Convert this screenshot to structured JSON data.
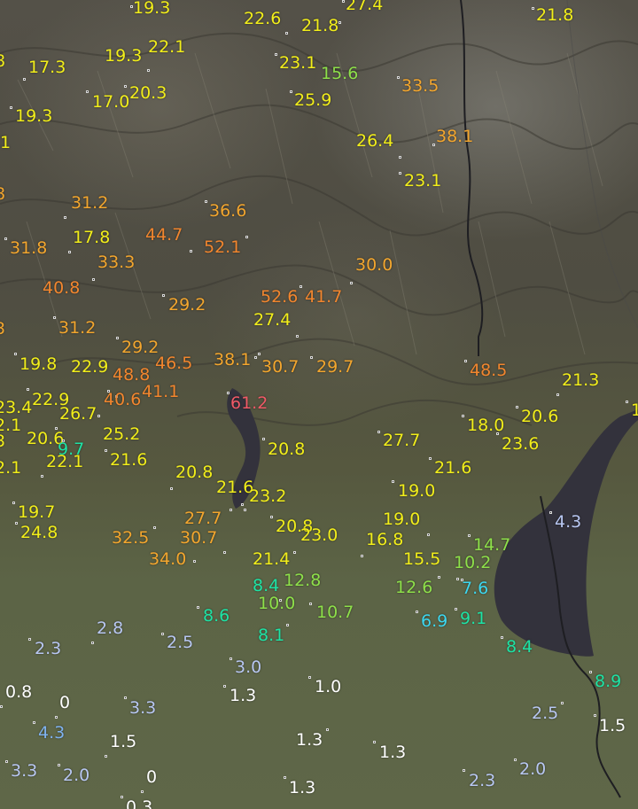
{
  "map": {
    "colors": {
      "water": "#33323c",
      "white": "#ffffff",
      "lightblue": "#b8c7f2",
      "blue": "#7fb2ee",
      "cyan": "#3cd7f0",
      "teal": "#1ee3a5",
      "green": "#8ee04a",
      "yellow": "#f2ee1a",
      "orange": "#f3a62e",
      "darkorange": "#f2862e",
      "red": "#f05a67"
    },
    "stations": [
      {
        "text": "19.3",
        "c": "yellow"
      },
      {
        "text": "22.6",
        "c": "yellow"
      },
      {
        "text": "21.8",
        "c": "yellow"
      },
      {
        "text": "27.4",
        "c": "yellow"
      },
      {
        "text": "21.8",
        "c": "yellow"
      },
      {
        "text": "17.3",
        "c": "yellow"
      },
      {
        "text": "19.3",
        "c": "yellow"
      },
      {
        "text": "22.1",
        "c": "yellow"
      },
      {
        "text": "23.1",
        "c": "yellow"
      },
      {
        "text": "15.6",
        "c": "green"
      },
      {
        "text": "33.5",
        "c": "orange"
      },
      {
        "text": "17.0",
        "c": "yellow"
      },
      {
        "text": "20.3",
        "c": "yellow"
      },
      {
        "text": "25.9",
        "c": "yellow"
      },
      {
        "text": "19.3",
        "c": "yellow"
      },
      {
        "text": "26.4",
        "c": "yellow"
      },
      {
        "text": "38.1",
        "c": "orange"
      },
      {
        "text": "23.1",
        "c": "yellow"
      },
      {
        "text": "31.2",
        "c": "orange"
      },
      {
        "text": "36.6",
        "c": "orange"
      },
      {
        "text": "17.8",
        "c": "yellow"
      },
      {
        "text": "44.7",
        "c": "darkorange"
      },
      {
        "text": "52.1",
        "c": "darkorange"
      },
      {
        "text": "31.8",
        "c": "orange"
      },
      {
        "text": "33.3",
        "c": "orange"
      },
      {
        "text": "30.0",
        "c": "orange"
      },
      {
        "text": "40.8",
        "c": "darkorange"
      },
      {
        "text": "52.6",
        "c": "darkorange"
      },
      {
        "text": "41.7",
        "c": "darkorange"
      },
      {
        "text": "29.2",
        "c": "orange"
      },
      {
        "text": "27.4",
        "c": "yellow"
      },
      {
        "text": "31.2",
        "c": "orange"
      },
      {
        "text": "29.2",
        "c": "orange"
      },
      {
        "text": "19.8",
        "c": "yellow"
      },
      {
        "text": "22.9",
        "c": "yellow"
      },
      {
        "text": "48.8",
        "c": "darkorange"
      },
      {
        "text": "46.5",
        "c": "darkorange"
      },
      {
        "text": "38.1",
        "c": "orange"
      },
      {
        "text": "30.7",
        "c": "orange"
      },
      {
        "text": "29.7",
        "c": "orange"
      },
      {
        "text": "48.5",
        "c": "darkorange"
      },
      {
        "text": "21.3",
        "c": "yellow"
      },
      {
        "text": "22.9",
        "c": "yellow"
      },
      {
        "text": "40.6",
        "c": "darkorange"
      },
      {
        "text": "41.1",
        "c": "darkorange"
      },
      {
        "text": "61.2",
        "c": "red"
      },
      {
        "text": "23.4",
        "c": "yellow"
      },
      {
        "text": "26.7",
        "c": "yellow"
      },
      {
        "text": "18.0",
        "c": "yellow"
      },
      {
        "text": "20.6",
        "c": "yellow"
      },
      {
        "text": "2.1",
        "c": "yellow"
      },
      {
        "text": "20.6",
        "c": "yellow"
      },
      {
        "text": "25.2",
        "c": "yellow"
      },
      {
        "text": "27.7",
        "c": "yellow"
      },
      {
        "text": "23.6",
        "c": "yellow"
      },
      {
        "text": "3",
        "c": "yellow"
      },
      {
        "text": "9.7",
        "c": "teal"
      },
      {
        "text": "20.8",
        "c": "yellow"
      },
      {
        "text": "2.1",
        "c": "yellow"
      },
      {
        "text": "22.1",
        "c": "yellow"
      },
      {
        "text": "21.6",
        "c": "yellow"
      },
      {
        "text": "20.8",
        "c": "yellow"
      },
      {
        "text": "21.6",
        "c": "yellow"
      },
      {
        "text": "21.6",
        "c": "yellow"
      },
      {
        "text": "19.0",
        "c": "yellow"
      },
      {
        "text": "23.2",
        "c": "yellow"
      },
      {
        "text": "19.7",
        "c": "yellow"
      },
      {
        "text": "27.7",
        "c": "orange"
      },
      {
        "text": "19.0",
        "c": "yellow"
      },
      {
        "text": "4.3",
        "c": "lightblue"
      },
      {
        "text": "24.8",
        "c": "yellow"
      },
      {
        "text": "20.8",
        "c": "yellow"
      },
      {
        "text": "23.0",
        "c": "yellow"
      },
      {
        "text": "32.5",
        "c": "orange"
      },
      {
        "text": "30.7",
        "c": "orange"
      },
      {
        "text": "16.8",
        "c": "yellow"
      },
      {
        "text": "14.7",
        "c": "green"
      },
      {
        "text": "34.0",
        "c": "orange"
      },
      {
        "text": "21.4",
        "c": "yellow"
      },
      {
        "text": "15.5",
        "c": "yellow"
      },
      {
        "text": "10.2",
        "c": "green"
      },
      {
        "text": "12.8",
        "c": "green"
      },
      {
        "text": "8.4",
        "c": "teal"
      },
      {
        "text": "12.6",
        "c": "green"
      },
      {
        "text": "7.6",
        "c": "cyan"
      },
      {
        "text": "10.0",
        "c": "green"
      },
      {
        "text": "10.7",
        "c": "green"
      },
      {
        "text": "8.6",
        "c": "teal"
      },
      {
        "text": "6.9",
        "c": "cyan"
      },
      {
        "text": "9.1",
        "c": "teal"
      },
      {
        "text": "2.8",
        "c": "lightblue"
      },
      {
        "text": "8.1",
        "c": "teal"
      },
      {
        "text": "2.5",
        "c": "lightblue"
      },
      {
        "text": "2.3",
        "c": "lightblue"
      },
      {
        "text": "8.4",
        "c": "teal"
      },
      {
        "text": "3.0",
        "c": "lightblue"
      },
      {
        "text": "8.9",
        "c": "teal"
      },
      {
        "text": "0.8",
        "c": "white"
      },
      {
        "text": "1.3",
        "c": "white"
      },
      {
        "text": "1.0",
        "c": "white"
      },
      {
        "text": "3.3",
        "c": "lightblue"
      },
      {
        "text": "2.5",
        "c": "lightblue"
      },
      {
        "text": "4.3",
        "c": "blue"
      },
      {
        "text": "1.5",
        "c": "white"
      },
      {
        "text": "1.5",
        "c": "white"
      },
      {
        "text": "1.3",
        "c": "white"
      },
      {
        "text": "1.3",
        "c": "white"
      },
      {
        "text": "3.3",
        "c": "lightblue"
      },
      {
        "text": "2.0",
        "c": "lightblue"
      },
      {
        "text": "2.0",
        "c": "lightblue"
      },
      {
        "text": "2.3",
        "c": "lightblue"
      },
      {
        "text": "1.3",
        "c": "white"
      },
      {
        "text": "0.3",
        "c": "white"
      },
      {
        "text": "0",
        "c": "white"
      },
      {
        "text": "0",
        "c": "white"
      },
      {
        "text": ".1",
        "c": "yellow"
      },
      {
        "text": "8",
        "c": "yellow"
      },
      {
        "text": "8",
        "c": "orange"
      },
      {
        "text": "3",
        "c": "orange"
      },
      {
        "text": "1",
        "c": "yellow"
      }
    ]
  }
}
